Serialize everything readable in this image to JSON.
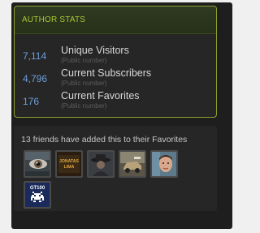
{
  "author_stats": {
    "header": "AUTHOR STATS",
    "rows": [
      {
        "value": "7,114",
        "label": "Unique Visitors",
        "sub": "(Public number)"
      },
      {
        "value": "4,796",
        "label": "Current Subscribers",
        "sub": "(Public number)"
      },
      {
        "value": "176",
        "label": "Current Favorites",
        "sub": "(Public number)"
      }
    ]
  },
  "friends": {
    "title": "13 friends have added this to their Favorites",
    "avatars": [
      {
        "icon": "eye-avatar-icon"
      },
      {
        "icon": "jonatas-lima-avatar-icon",
        "text_line1": "JONATAS",
        "text_line2": "LIMA"
      },
      {
        "icon": "hat-figure-avatar-icon"
      },
      {
        "icon": "vehicle-avatar-icon"
      },
      {
        "icon": "face-avatar-icon"
      },
      {
        "icon": "space-invader-avatar-icon",
        "text": "GT100"
      }
    ]
  },
  "colors": {
    "accent_green": "#a9c534",
    "stat_blue": "#6c9fdb",
    "panel_bg": "#1e1e1e"
  }
}
